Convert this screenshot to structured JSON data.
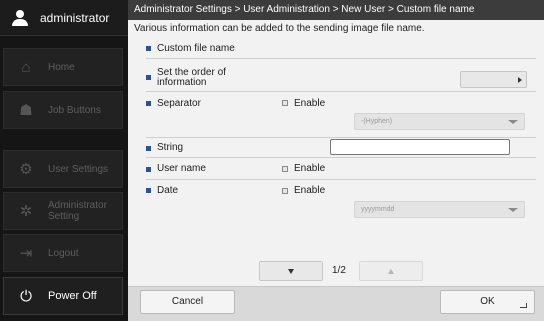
{
  "sidebar": {
    "user_label": "administrator",
    "items": [
      {
        "label": "Home",
        "icon": "home-icon",
        "glyph": "⌂"
      },
      {
        "label": "Job Buttons",
        "icon": "job-buttons-icon",
        "glyph": "☗"
      },
      {
        "label": "User Settings",
        "icon": "user-settings-icon",
        "glyph": "⚙"
      },
      {
        "label": "Administrator Setting",
        "icon": "admin-setting-gear-icon",
        "glyph": "✲"
      },
      {
        "label": "Logout",
        "icon": "logout-icon",
        "glyph": "⇥"
      },
      {
        "label": "Power Off",
        "icon": "power-icon",
        "glyph": "⏻"
      }
    ]
  },
  "main": {
    "breadcrumb": "Administrator Settings > User Administration > New User > Custom file name",
    "description": "Various information can be added to the sending image file name.",
    "rows": {
      "custom_file_name": "Custom file name",
      "set_order": "Set the order of information",
      "separator": "Separator",
      "string": "String",
      "user_name": "User name",
      "date": "Date"
    },
    "enable_label": "Enable",
    "separator_select": "-(Hyphen)",
    "date_select": "yyyymmdd",
    "string_value": "",
    "page_indicator": "1/2",
    "cancel_label": "Cancel",
    "ok_label": "OK"
  },
  "colors": {
    "accent_bullet": "#2a4fa8",
    "breadcrumb_bg": "#3c3c3c",
    "sidebar_bg": "#151515"
  }
}
